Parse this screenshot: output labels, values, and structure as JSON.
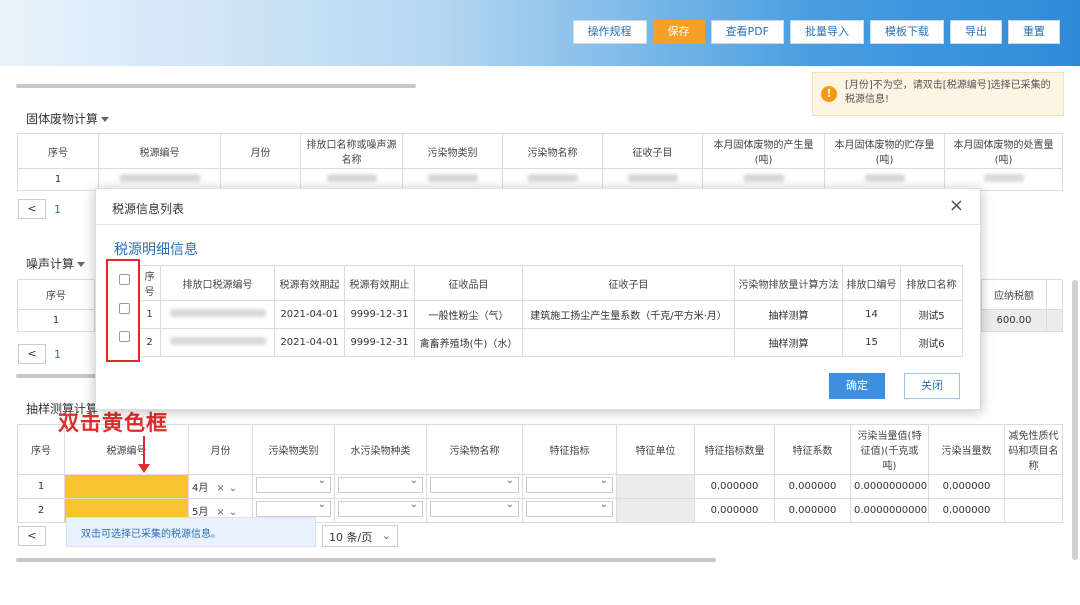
{
  "toolbar": {
    "buttons": [
      "操作规程",
      "保存",
      "查看PDF",
      "批量导入",
      "模板下载",
      "导出",
      "重置"
    ]
  },
  "warning": {
    "text": "[月份]不为空，请双击[税源编号]选择已采集的税源信息!"
  },
  "solid_waste": {
    "title": "固体废物计算",
    "headers": [
      "序号",
      "税源编号",
      "月份",
      "排放口名称或噪声源名称",
      "污染物类别",
      "污染物名称",
      "征收子目",
      "本月固体废物的产生量(吨)",
      "本月固体废物的贮存量(吨)",
      "本月固体废物的处置量(吨)"
    ],
    "row_index": "1"
  },
  "pager1": {
    "prev": "<",
    "page": "1"
  },
  "noise": {
    "title": "噪声计算",
    "headers": [
      "序号"
    ],
    "row_index": "1",
    "right_header": "应纳税额",
    "right_value": "600.00"
  },
  "pager2": {
    "prev": "<",
    "page": "1"
  },
  "modal": {
    "title": "税源信息列表",
    "close": "×",
    "subtitle": "税源明细信息",
    "headers": [
      "序号",
      "排放口税源编号",
      "税源有效期起",
      "税源有效期止",
      "征收品目",
      "征收子目",
      "污染物排放量计算方法",
      "排放口编号",
      "排放口名称"
    ],
    "rows": [
      {
        "index": "1",
        "start": "2021-04-01",
        "end": "9999-12-31",
        "item": "一般性粉尘（气）",
        "sub": "建筑施工扬尘产生量系数（千克/平方米·月）",
        "method": "抽样测算",
        "code": "14",
        "name": "测试5"
      },
      {
        "index": "2",
        "start": "2021-04-01",
        "end": "9999-12-31",
        "item": "禽畜养殖场(牛)（水）",
        "sub": "",
        "method": "抽样测算",
        "code": "15",
        "name": "测试6"
      }
    ],
    "confirm": "确定",
    "cancel": "关闭"
  },
  "annotation": "双击黄色框",
  "sampling": {
    "title": "抽样测算计算",
    "headers": [
      "序号",
      "税源编号",
      "月份",
      "污染物类别",
      "水污染物种类",
      "污染物名称",
      "特征指标",
      "特征单位",
      "特征指标数量",
      "特征系数",
      "污染当量值(特征值)(千克或吨)",
      "污染当量数",
      "减免性质代码和项目名称"
    ],
    "rows": [
      {
        "index": "1",
        "month": "4月",
        "qty": "0.000000",
        "coef": "0.000000",
        "eq": "0.0000000000",
        "eqn": "0.000000"
      },
      {
        "index": "2",
        "month": "5月",
        "qty": "0.000000",
        "coef": "0.000000",
        "eq": "0.0000000000",
        "eqn": "0.000000"
      }
    ]
  },
  "hint": "双击可选择已采集的税源信息。",
  "pager3": {
    "prev": "<",
    "per_page": "10 条/页"
  },
  "colors": {
    "accent": "#2c6fb6",
    "save": "#f5a024",
    "annotation": "#e02b2b",
    "highlight": "#f7c32e"
  }
}
